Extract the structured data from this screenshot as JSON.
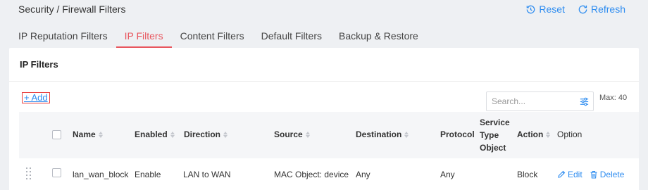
{
  "breadcrumb": "Security / Firewall Filters",
  "actions": {
    "reset": "Reset",
    "refresh": "Refresh"
  },
  "tabs": [
    {
      "label": "IP Reputation Filters",
      "active": false
    },
    {
      "label": "IP Filters",
      "active": true
    },
    {
      "label": "Content Filters",
      "active": false
    },
    {
      "label": "Default Filters",
      "active": false
    },
    {
      "label": "Backup & Restore",
      "active": false
    }
  ],
  "card": {
    "title": "IP Filters"
  },
  "toolbar": {
    "add_label": "+ Add",
    "search_placeholder": "Search...",
    "max_label": "Max: 40"
  },
  "table": {
    "columns": {
      "name": "Name",
      "enabled": "Enabled",
      "direction": "Direction",
      "source": "Source",
      "destination": "Destination",
      "protocol": "Protocol",
      "service_line1": "Service",
      "service_line2": "Type",
      "service_line3": "Object",
      "action": "Action",
      "option": "Option"
    },
    "rows": [
      {
        "name": "lan_wan_block",
        "enabled": "Enable",
        "direction": "LAN to WAN",
        "source": "MAC Object: device",
        "destination": "Any",
        "protocol": "Any",
        "service": "",
        "action": "Block",
        "edit_label": "Edit",
        "delete_label": "Delete"
      }
    ]
  },
  "colors": {
    "accent": "#2d8cf0",
    "active_tab": "#e8565e"
  }
}
